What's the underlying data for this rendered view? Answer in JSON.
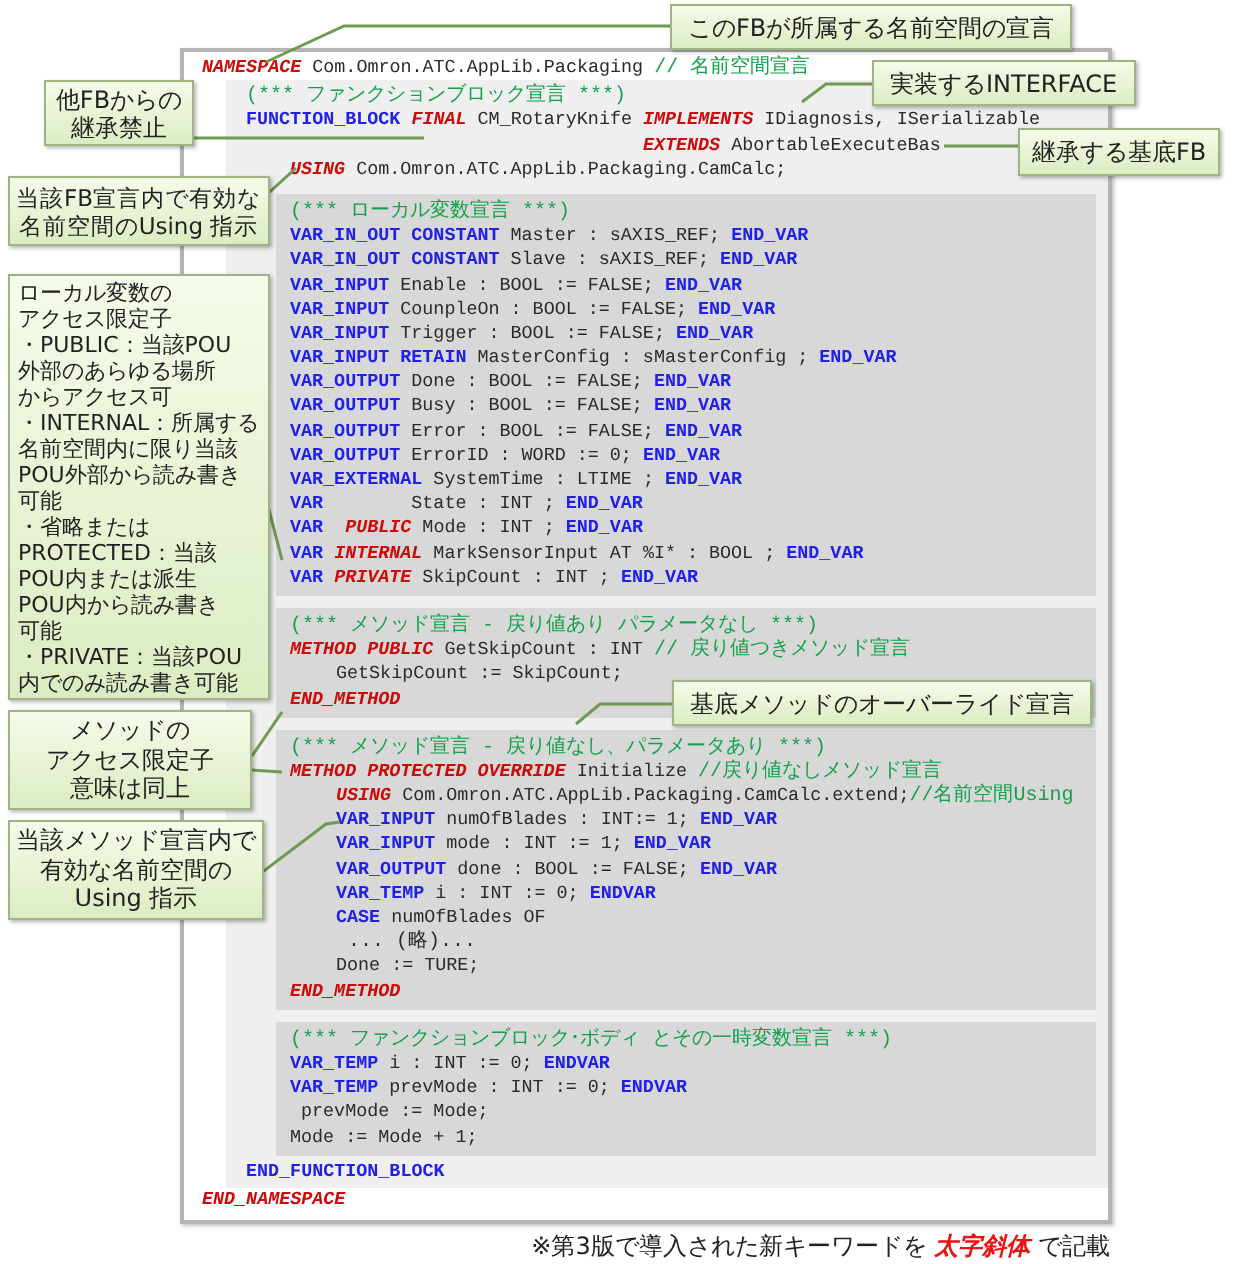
{
  "code": {
    "namespace_line": {
      "tokens": [
        {
          "kind": "new_keyword",
          "text": "NAMESPACE"
        },
        {
          "kind": "text",
          "text": " Com.Omron.ATC.AppLib.Packaging "
        },
        {
          "kind": "comment",
          "text": "// 名前空間宣言"
        }
      ]
    },
    "function_block": {
      "header": [
        {
          "kind": "comment",
          "tokens": [
            {
              "kind": "comment",
              "text": "(*** ファンクションブロック宣言 ***)"
            }
          ]
        },
        {
          "kind": "declaration",
          "tokens": [
            {
              "kind": "keyword",
              "text": "FUNCTION_BLOCK "
            },
            {
              "kind": "new_keyword",
              "text": "FINAL"
            },
            {
              "kind": "text",
              "text": " CM_RotaryKnife "
            },
            {
              "kind": "new_keyword",
              "text": "IMPLEMENTS"
            },
            {
              "kind": "text",
              "text": " IDiagnosis, ISerializable"
            }
          ]
        },
        {
          "kind": "continuation",
          "tokens": [
            {
              "kind": "new_keyword",
              "text": "EXTENDS"
            },
            {
              "kind": "text",
              "text": " AbortableExecuteBas"
            }
          ]
        },
        {
          "kind": "using",
          "tokens": [
            {
              "kind": "new_keyword",
              "text": "USING"
            },
            {
              "kind": "text",
              "text": " Com.Omron.ATC.AppLib.Packaging.CamCalc;"
            }
          ]
        }
      ],
      "sections": [
        {
          "lines": [
            {
              "tokens": [
                {
                  "kind": "comment",
                  "text": "(*** ローカル変数宣言 ***)"
                }
              ]
            },
            {
              "tokens": [
                {
                  "kind": "keyword",
                  "text": "VAR_IN_OUT CONSTANT"
                },
                {
                  "kind": "text",
                  "text": " Master : sAXIS_REF; "
                },
                {
                  "kind": "keyword",
                  "text": "END_VAR"
                }
              ]
            },
            {
              "tokens": [
                {
                  "kind": "keyword",
                  "text": "VAR_IN_OUT CONSTANT"
                },
                {
                  "kind": "text",
                  "text": " Slave : sAXIS_REF; "
                },
                {
                  "kind": "keyword",
                  "text": "END_VAR"
                }
              ]
            },
            {
              "tokens": [
                {
                  "kind": "keyword",
                  "text": "VAR_INPUT"
                },
                {
                  "kind": "text",
                  "text": " Enable : BOOL := FALSE; "
                },
                {
                  "kind": "keyword",
                  "text": "END_VAR"
                }
              ]
            },
            {
              "tokens": [
                {
                  "kind": "keyword",
                  "text": "VAR_INPUT"
                },
                {
                  "kind": "text",
                  "text": " CounpleOn : BOOL := FALSE; "
                },
                {
                  "kind": "keyword",
                  "text": "END_VAR"
                }
              ]
            },
            {
              "tokens": [
                {
                  "kind": "keyword",
                  "text": "VAR_INPUT"
                },
                {
                  "kind": "text",
                  "text": " Trigger : BOOL := FALSE; "
                },
                {
                  "kind": "keyword",
                  "text": "END_VAR"
                }
              ]
            },
            {
              "tokens": [
                {
                  "kind": "keyword",
                  "text": "VAR_INPUT RETAIN"
                },
                {
                  "kind": "text",
                  "text": " MasterConfig : sMasterConfig ; "
                },
                {
                  "kind": "keyword",
                  "text": "END_VAR"
                }
              ]
            },
            {
              "tokens": [
                {
                  "kind": "keyword",
                  "text": "VAR_OUTPUT"
                },
                {
                  "kind": "text",
                  "text": " Done : BOOL := FALSE; "
                },
                {
                  "kind": "keyword",
                  "text": "END_VAR"
                }
              ]
            },
            {
              "tokens": [
                {
                  "kind": "keyword",
                  "text": "VAR_OUTPUT"
                },
                {
                  "kind": "text",
                  "text": " Busy : BOOL := FALSE; "
                },
                {
                  "kind": "keyword",
                  "text": "END_VAR"
                }
              ]
            },
            {
              "tokens": [
                {
                  "kind": "keyword",
                  "text": "VAR_OUTPUT"
                },
                {
                  "kind": "text",
                  "text": " Error : BOOL := FALSE; "
                },
                {
                  "kind": "keyword",
                  "text": "END_VAR"
                }
              ]
            },
            {
              "tokens": [
                {
                  "kind": "keyword",
                  "text": "VAR_OUTPUT"
                },
                {
                  "kind": "text",
                  "text": " ErrorID : WORD := 0; "
                },
                {
                  "kind": "keyword",
                  "text": "END_VAR"
                }
              ]
            },
            {
              "tokens": [
                {
                  "kind": "keyword",
                  "text": "VAR_EXTERNAL"
                },
                {
                  "kind": "text",
                  "text": " SystemTime : LTIME ; "
                },
                {
                  "kind": "keyword",
                  "text": "END_VAR"
                }
              ]
            },
            {
              "tokens": [
                {
                  "kind": "keyword",
                  "text": "VAR"
                },
                {
                  "kind": "text",
                  "text": "        State : INT ; "
                },
                {
                  "kind": "keyword",
                  "text": "END_VAR"
                }
              ]
            },
            {
              "tokens": [
                {
                  "kind": "keyword",
                  "text": "VAR  "
                },
                {
                  "kind": "new_keyword",
                  "text": "PUBLIC"
                },
                {
                  "kind": "text",
                  "text": " Mode : INT ; "
                },
                {
                  "kind": "keyword",
                  "text": "END_VAR"
                }
              ]
            },
            {
              "tokens": [
                {
                  "kind": "keyword",
                  "text": "VAR "
                },
                {
                  "kind": "new_keyword",
                  "text": "INTERNAL"
                },
                {
                  "kind": "text",
                  "text": " MarkSensorInput AT %I* : BOOL ; "
                },
                {
                  "kind": "keyword",
                  "text": "END_VAR"
                }
              ]
            },
            {
              "tokens": [
                {
                  "kind": "keyword",
                  "text": "VAR "
                },
                {
                  "kind": "new_keyword",
                  "text": "PRIVATE"
                },
                {
                  "kind": "text",
                  "text": " SkipCount : INT ; "
                },
                {
                  "kind": "keyword",
                  "text": "END_VAR"
                }
              ]
            }
          ]
        },
        {
          "lines": [
            {
              "tokens": [
                {
                  "kind": "comment",
                  "text": "(*** メソッド宣言 - 戻り値あり パラメータなし ***)"
                }
              ]
            },
            {
              "tokens": [
                {
                  "kind": "new_keyword",
                  "text": "METHOD PUBLIC"
                },
                {
                  "kind": "text",
                  "text": " GetSkipCount : INT "
                },
                {
                  "kind": "comment",
                  "text": "// 戻り値つきメソッド宣言"
                }
              ],
              "children": [
                {
                  "tokens": [
                    {
                      "kind": "text",
                      "text": "GetSkipCount := SkipCount;"
                    }
                  ]
                }
              ]
            },
            {
              "tokens": [
                {
                  "kind": "new_keyword",
                  "text": "END_METHOD"
                }
              ]
            }
          ]
        },
        {
          "lines": [
            {
              "tokens": [
                {
                  "kind": "comment",
                  "text": "(*** メソッド宣言 - 戻り値なし、パラメータあり ***)"
                }
              ]
            },
            {
              "tokens": [
                {
                  "kind": "new_keyword",
                  "text": "METHOD PROTECTED OVERRIDE"
                },
                {
                  "kind": "text",
                  "text": " Initialize "
                },
                {
                  "kind": "comment",
                  "text": "//戻り値なしメソッド宣言"
                }
              ],
              "children": [
                {
                  "tokens": [
                    {
                      "kind": "new_keyword",
                      "text": "USING"
                    },
                    {
                      "kind": "text",
                      "text": " Com.Omron.ATC.AppLib.Packaging.CamCalc.extend;"
                    },
                    {
                      "kind": "comment",
                      "text": "//名前空間Using"
                    }
                  ]
                },
                {
                  "tokens": [
                    {
                      "kind": "keyword",
                      "text": "VAR_INPUT"
                    },
                    {
                      "kind": "text",
                      "text": " numOfBlades : INT:= 1; "
                    },
                    {
                      "kind": "keyword",
                      "text": "END_VAR"
                    }
                  ]
                },
                {
                  "tokens": [
                    {
                      "kind": "keyword",
                      "text": "VAR_INPUT"
                    },
                    {
                      "kind": "text",
                      "text": " mode : INT := 1; "
                    },
                    {
                      "kind": "keyword",
                      "text": "END_VAR"
                    }
                  ]
                },
                {
                  "tokens": [
                    {
                      "kind": "keyword",
                      "text": "VAR_OUTPUT"
                    },
                    {
                      "kind": "text",
                      "text": " done : BOOL := FALSE; "
                    },
                    {
                      "kind": "keyword",
                      "text": "END_VAR"
                    }
                  ]
                },
                {
                  "tokens": [
                    {
                      "kind": "keyword",
                      "text": "VAR_TEMP"
                    },
                    {
                      "kind": "text",
                      "text": " i : INT := 0; "
                    },
                    {
                      "kind": "keyword",
                      "text": "ENDVAR"
                    }
                  ]
                },
                {
                  "tokens": [
                    {
                      "kind": "keyword",
                      "text": "CASE"
                    },
                    {
                      "kind": "text",
                      "text": " numOfBlades OF"
                    }
                  ]
                },
                {
                  "tokens": [
                    {
                      "kind": "note",
                      "text": " ... (略)..."
                    }
                  ]
                },
                {
                  "tokens": [
                    {
                      "kind": "text",
                      "text": "Done := TURE;"
                    }
                  ]
                }
              ]
            },
            {
              "tokens": [
                {
                  "kind": "new_keyword",
                  "text": "END_METHOD"
                }
              ]
            }
          ]
        },
        {
          "lines": [
            {
              "tokens": [
                {
                  "kind": "comment",
                  "text": "(*** ファンクションブロック･ボディ とその一時変数宣言 ***)"
                }
              ]
            },
            {
              "tokens": [
                {
                  "kind": "keyword",
                  "text": "VAR_TEMP"
                },
                {
                  "kind": "text",
                  "text": " i : INT := 0; "
                },
                {
                  "kind": "keyword",
                  "text": "ENDVAR"
                }
              ]
            },
            {
              "tokens": [
                {
                  "kind": "keyword",
                  "text": "VAR_TEMP"
                },
                {
                  "kind": "text",
                  "text": " prevMode : INT := 0; "
                },
                {
                  "kind": "keyword",
                  "text": "ENDVAR"
                }
              ]
            },
            {
              "tokens": [
                {
                  "kind": "text",
                  "text": " prevMode := Mode;"
                }
              ]
            },
            {
              "tokens": [
                {
                  "kind": "text",
                  "text": "Mode := Mode + 1;"
                }
              ]
            }
          ]
        }
      ],
      "footer": {
        "tokens": [
          {
            "kind": "keyword",
            "text": "END_FUNCTION_BLOCK"
          }
        ]
      }
    },
    "end_line": {
      "tokens": [
        {
          "kind": "new_keyword",
          "text": "END_NAMESPACE"
        }
      ]
    }
  },
  "callouts": [
    {
      "lines": [
        "このFBが所属する名前空間の宣言"
      ]
    },
    {
      "lines": [
        "実装するINTERFACE"
      ]
    },
    {
      "lines": [
        "他FBからの",
        "継承禁止"
      ]
    },
    {
      "lines": [
        "継承する基底FB"
      ]
    },
    {
      "lines": [
        "当該FB宣言内で有効な",
        "名前空間のUsing 指示"
      ]
    },
    {
      "lines": [
        "ローカル変数の",
        "アクセス限定子",
        "・PUBLIC：当該POU",
        "外部のあらゆる場所",
        "からアクセス可",
        "・INTERNAL：所属する",
        "名前空間内に限り当該",
        "POU外部から読み書き",
        "可能",
        "・省略または",
        "PROTECTED：当該",
        "POU内または派生",
        "POU内から読み書き",
        "可能",
        "・PRIVATE：当該POU",
        "内でのみ読み書き可能"
      ]
    },
    {
      "lines": [
        "基底メソッドのオーバーライド宣言"
      ]
    },
    {
      "lines": [
        "メソッドの",
        "アクセス限定子",
        "意味は同上"
      ]
    },
    {
      "lines": [
        "当該メソッド宣言内で",
        "有効な名前空間の",
        "Using 指示"
      ]
    }
  ],
  "footnote": "※第3版で導入された新キーワードを **太字斜体** で記載"
}
